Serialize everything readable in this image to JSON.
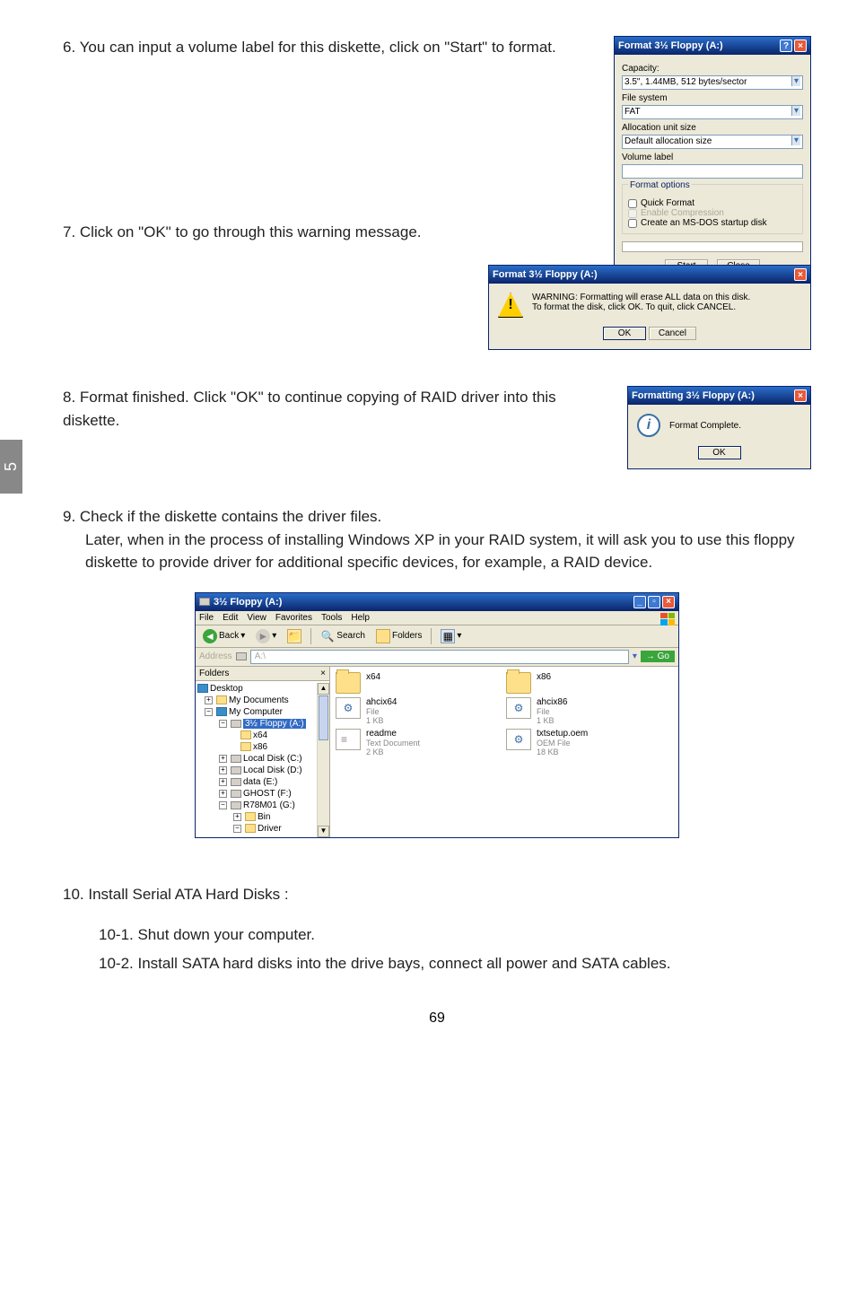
{
  "pageTab": "5",
  "pageNumber": "69",
  "steps": {
    "s6": "6. You can input a volume label for this diskette, click on \"Start\" to format.",
    "s7": "7. Click on \"OK\" to go through this warning message.",
    "s8": "8. Format finished. Click \"OK\" to continue copying of RAID driver into this diskette.",
    "s9": "9. Check if the diskette contains the driver files.",
    "s9_body": "Later, when in the process of installing Windows XP in your RAID system, it will ask you to use this floppy diskette to provide driver for additional specific devices, for example, a RAID device.",
    "s10": "10. Install Serial ATA Hard Disks :",
    "s10_1": "10-1. Shut down your computer.",
    "s10_2": "10-2. Install SATA hard disks into the drive bays, connect all power and SATA cables."
  },
  "formatDialog": {
    "title": "Format 3½ Floppy (A:)",
    "labels": {
      "cap": "Capacity:",
      "fs": "File system",
      "alloc": "Allocation unit size",
      "vol": "Volume label",
      "opts": "Format options"
    },
    "capacity": "3.5\", 1.44MB, 512 bytes/sector",
    "fs": "FAT",
    "alloc": "Default allocation size",
    "volume": "",
    "quick": "Quick Format",
    "compress": "Enable Compression",
    "msdos": "Create an MS-DOS startup disk",
    "start": "Start",
    "close": "Close"
  },
  "warnDialog": {
    "title": "Format 3½ Floppy (A:)",
    "msg": "WARNING: Formatting will erase ALL data on this disk.\nTo format the disk, click OK. To quit, click CANCEL.",
    "ok": "OK",
    "cancel": "Cancel"
  },
  "completeDialog": {
    "title": "Formatting 3½ Floppy (A:)",
    "msg": "Format Complete.",
    "ok": "OK"
  },
  "explorer": {
    "title": "3½ Floppy (A:)",
    "menu": [
      "File",
      "Edit",
      "View",
      "Favorites",
      "Tools",
      "Help"
    ],
    "toolbar": {
      "back": "Back",
      "search": "Search",
      "folders": "Folders"
    },
    "addressLabel": "Address",
    "address": "A:\\",
    "go": "Go",
    "foldersPanel": "Folders",
    "tree": {
      "desktop": "Desktop",
      "mydocs": "My Documents",
      "mycomp": "My Computer",
      "floppy": "3½ Floppy (A:)",
      "x64f": "x64",
      "x86f": "x86",
      "c": "Local Disk (C:)",
      "d": "Local Disk (D:)",
      "e": "data (E:)",
      "f": "GHOST (F:)",
      "g": "R78M01 (G:)",
      "bin": "Bin",
      "driver": "Driver"
    },
    "files": [
      {
        "name": "x64",
        "type": "folder",
        "sub": ""
      },
      {
        "name": "x86",
        "type": "folder",
        "sub": ""
      },
      {
        "name": "ahcix64",
        "type": "ini",
        "sub": "File\n1 KB"
      },
      {
        "name": "ahcix86",
        "type": "ini",
        "sub": "File\n1 KB"
      },
      {
        "name": "readme",
        "type": "txt",
        "sub": "Text Document\n2 KB"
      },
      {
        "name": "txtsetup.oem",
        "type": "ini",
        "sub": "OEM File\n18 KB"
      }
    ]
  }
}
